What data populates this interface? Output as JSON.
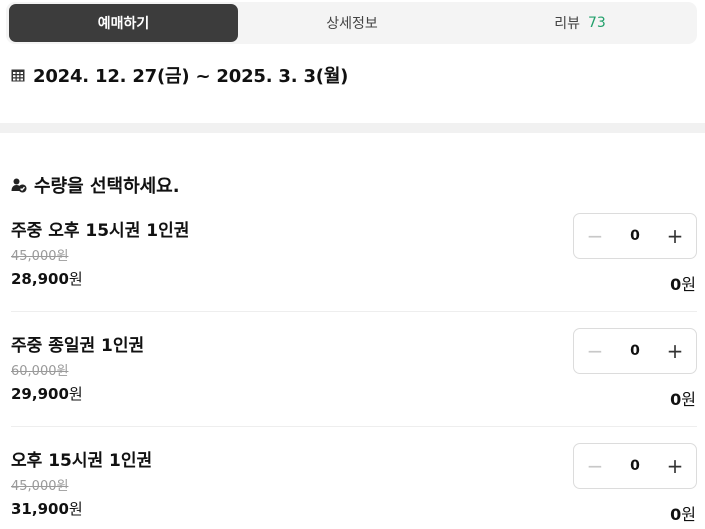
{
  "tabs": [
    {
      "label": "예매하기",
      "active": true
    },
    {
      "label": "상세정보",
      "active": false
    },
    {
      "label": "리뷰",
      "count": "73",
      "active": false
    }
  ],
  "date_range": "2024. 12. 27(금) ~ 2025. 3. 3(월)",
  "quantity_section": {
    "title": "수량을 선택하세요."
  },
  "tickets": [
    {
      "name": "주중 오후 15시권 1인권",
      "original_price": "45,000원",
      "price_amount": "28,900",
      "price_unit": "원",
      "quantity": "0",
      "total_amount": "0",
      "total_unit": "원"
    },
    {
      "name": "주중 종일권 1인권",
      "original_price": "60,000원",
      "price_amount": "29,900",
      "price_unit": "원",
      "quantity": "0",
      "total_amount": "0",
      "total_unit": "원"
    },
    {
      "name": "오후 15시권 1인권",
      "original_price": "45,000원",
      "price_amount": "31,900",
      "price_unit": "원",
      "quantity": "0",
      "total_amount": "0",
      "total_unit": "원"
    }
  ],
  "colors": {
    "active_tab_bg": "#3c3c3c",
    "review_count": "#22a06b",
    "tab_bar_bg": "#f4f4f4"
  },
  "icons": {
    "calendar": "calendar-icon",
    "quantity": "person-check-icon",
    "minus": "minus-icon",
    "plus": "plus-icon"
  }
}
